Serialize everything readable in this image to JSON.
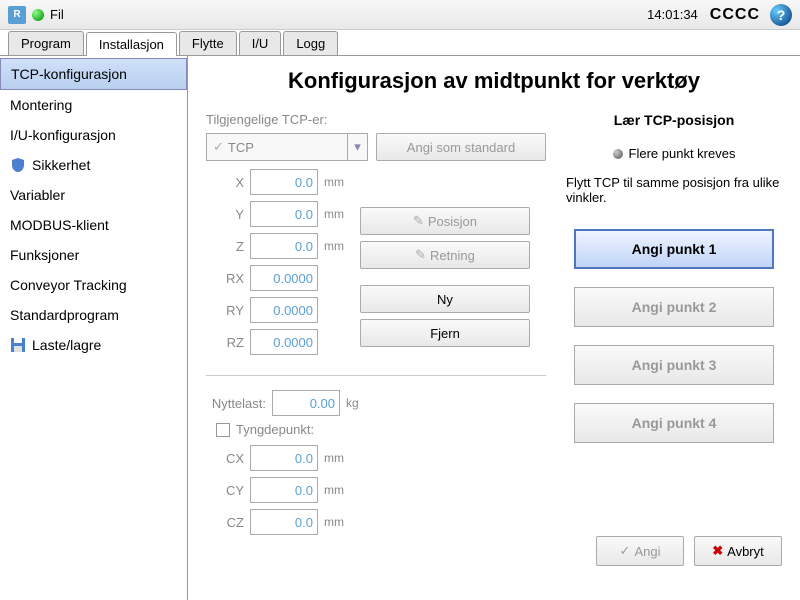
{
  "topbar": {
    "menu_file": "Fil",
    "clock": "14:01:34",
    "cccc": "CCCC"
  },
  "tabs": [
    {
      "label": "Program"
    },
    {
      "label": "Installasjon",
      "active": true
    },
    {
      "label": "Flytte"
    },
    {
      "label": "I/U"
    },
    {
      "label": "Logg"
    }
  ],
  "sidebar": [
    {
      "label": "TCP-konfigurasjon",
      "selected": true
    },
    {
      "label": "Montering"
    },
    {
      "label": "I/U-konfigurasjon"
    },
    {
      "label": "Sikkerhet",
      "icon": "shield"
    },
    {
      "label": "Variabler"
    },
    {
      "label": "MODBUS-klient"
    },
    {
      "label": "Funksjoner"
    },
    {
      "label": "Conveyor Tracking"
    },
    {
      "label": "Standardprogram"
    },
    {
      "label": "Laste/lagre",
      "icon": "disk"
    }
  ],
  "page": {
    "title": "Konfigurasjon av midtpunkt for verktøy",
    "available_label": "Tilgjengelige TCP-er:",
    "tcp_selected": "TCP",
    "set_default_btn": "Angi som standard",
    "fields": {
      "x": {
        "label": "X",
        "value": "0.0",
        "unit": "mm"
      },
      "y": {
        "label": "Y",
        "value": "0.0",
        "unit": "mm"
      },
      "z": {
        "label": "Z",
        "value": "0.0",
        "unit": "mm"
      },
      "rx": {
        "label": "RX",
        "value": "0.0000"
      },
      "ry": {
        "label": "RY",
        "value": "0.0000"
      },
      "rz": {
        "label": "RZ",
        "value": "0.0000"
      }
    },
    "btns": {
      "position": "Posisjon",
      "direction": "Retning",
      "new": "Ny",
      "remove": "Fjern"
    },
    "payload": {
      "label": "Nyttelast:",
      "value": "0.00",
      "unit": "kg"
    },
    "cog": {
      "checkbox_label": "Tyngdepunkt:",
      "cx": {
        "label": "CX",
        "value": "0.0",
        "unit": "mm"
      },
      "cy": {
        "label": "CY",
        "value": "0.0",
        "unit": "mm"
      },
      "cz": {
        "label": "CZ",
        "value": "0.0",
        "unit": "mm"
      }
    },
    "teach": {
      "title": "Lær TCP-posisjon",
      "info": "Flere punkt kreves",
      "desc": "Flytt TCP til samme posisjon fra ulike vinkler.",
      "p1": "Angi punkt 1",
      "p2": "Angi punkt 2",
      "p3": "Angi punkt 3",
      "p4": "Angi punkt 4",
      "set": "Angi",
      "cancel": "Avbryt"
    }
  }
}
